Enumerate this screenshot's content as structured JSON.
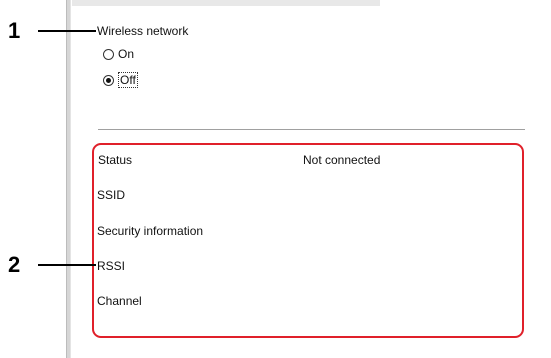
{
  "callouts": {
    "one": "1",
    "two": "2"
  },
  "wireless": {
    "section_label": "Wireless network",
    "options": [
      {
        "label": "On",
        "selected": false
      },
      {
        "label": "Off",
        "selected": true
      }
    ]
  },
  "status_panel": {
    "rows": [
      {
        "label": "Status",
        "value": "Not connected"
      },
      {
        "label": "SSID",
        "value": ""
      },
      {
        "label": "Security information",
        "value": ""
      },
      {
        "label": "RSSI",
        "value": ""
      },
      {
        "label": "Channel",
        "value": ""
      }
    ]
  },
  "colors": {
    "highlight": "#e0202a",
    "callout": "#000000"
  }
}
